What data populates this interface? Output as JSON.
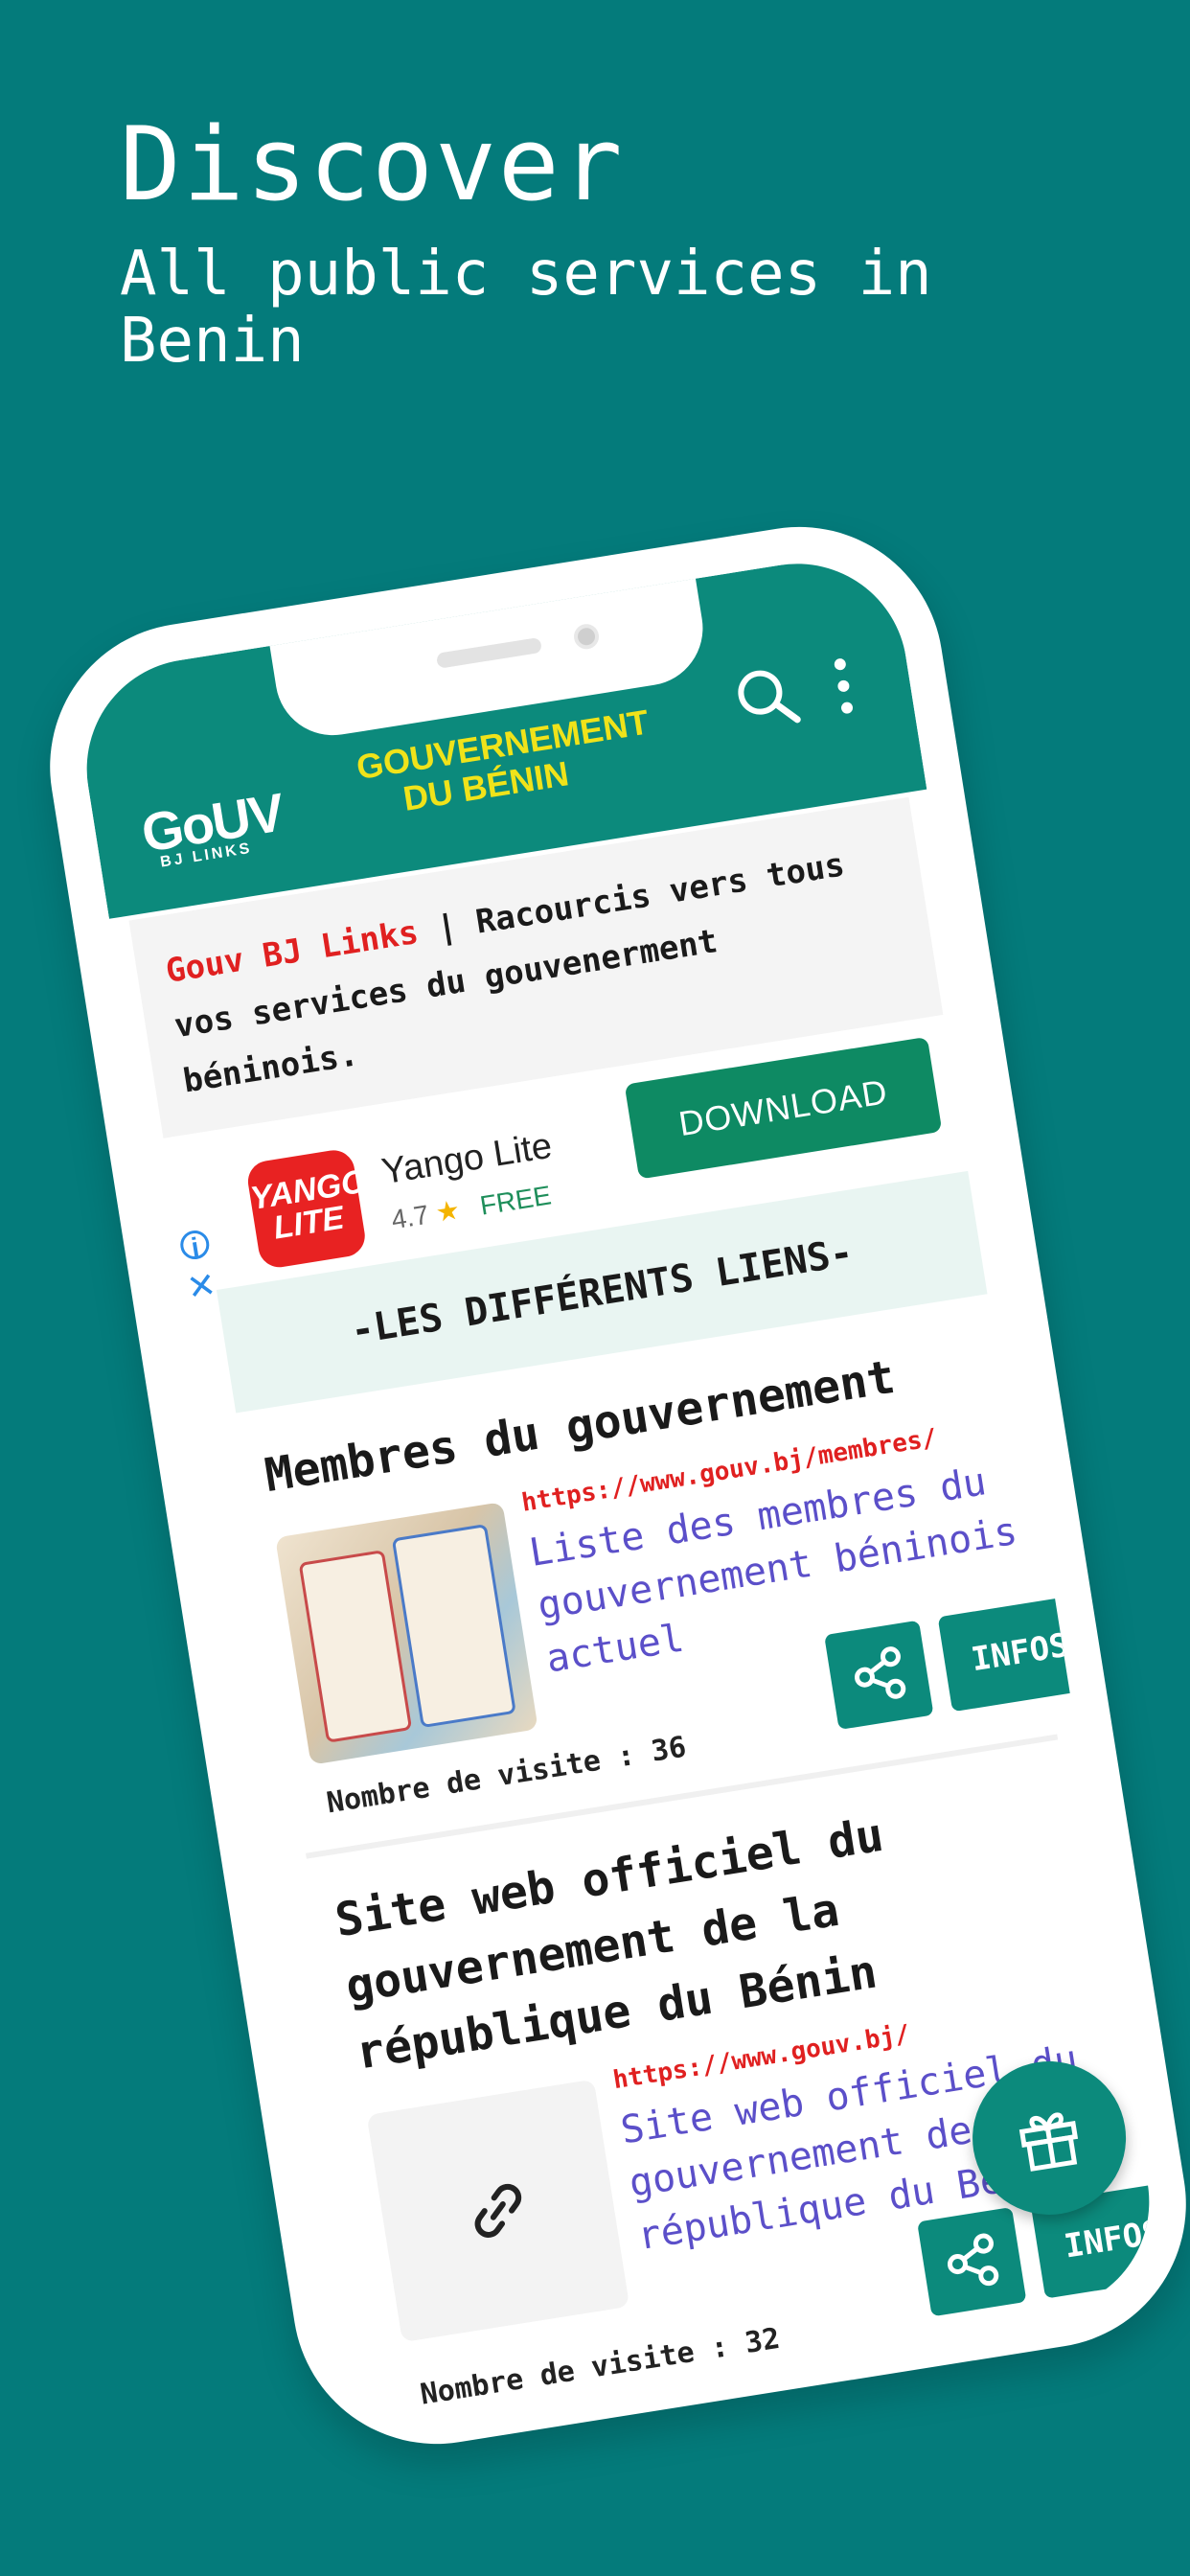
{
  "promo": {
    "headline": "Discover",
    "subline": "All public services in Benin"
  },
  "appbar": {
    "logo_main": "GoUV",
    "logo_sub": "BJ LINKS",
    "title_line1": "GOUVERNEMENT",
    "title_line2": "DU BÉNIN",
    "search_icon": "search-icon",
    "more_icon": "more-vertical-icon"
  },
  "intro": {
    "brand": "Gouv BJ Links",
    "separator": " | ",
    "text": "Racourcis vers tous vos services du gouvenerment béninois."
  },
  "ad": {
    "app_icon_text": "YANGO LITE",
    "app_name": "Yango Lite",
    "rating": "4.7",
    "star": "★",
    "price": "FREE",
    "download_label": "DOWNLOAD",
    "info_icon": "i",
    "close_icon": "✕"
  },
  "section": {
    "title": "-LES DIFFÉRENTS LIENS-"
  },
  "links": [
    {
      "title": "Membres du gouvernement",
      "url": "https://www.gouv.bj/membres/",
      "description": "Liste des membres du gouvernement béninois actuel",
      "visits_label": "Nombre de visite : 36",
      "infos_label": "INFOS..."
    },
    {
      "title": "Site web officiel du gouvernement de la république du Bénin",
      "url": "https://www.gouv.bj/",
      "description": "Site web officiel du gouvernement de la république du Bénin",
      "visits_label": "Nombre de visite : 32",
      "infos_label": "INFOS..."
    }
  ],
  "colors": {
    "background": "#047b7b",
    "primary": "#0c8a7c",
    "accent_yellow": "#f0e31a",
    "link_red": "#e02020",
    "desc_purple": "#5b4fc9"
  }
}
